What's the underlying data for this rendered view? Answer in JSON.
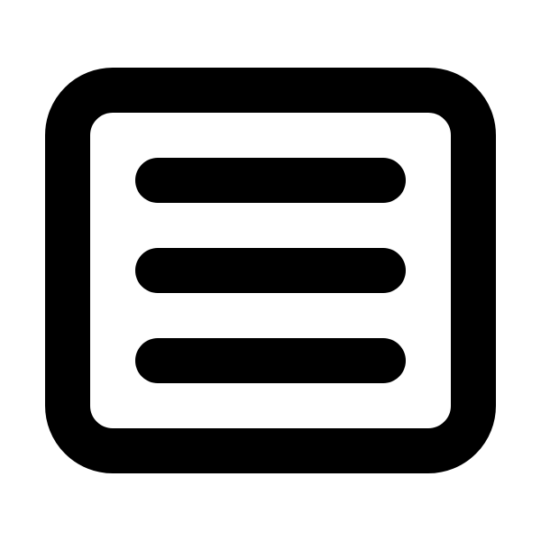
{
  "icon": {
    "name": "menu-list-icon",
    "stroke_color": "#000000",
    "background_color": "#ffffff",
    "line_count": 3
  }
}
